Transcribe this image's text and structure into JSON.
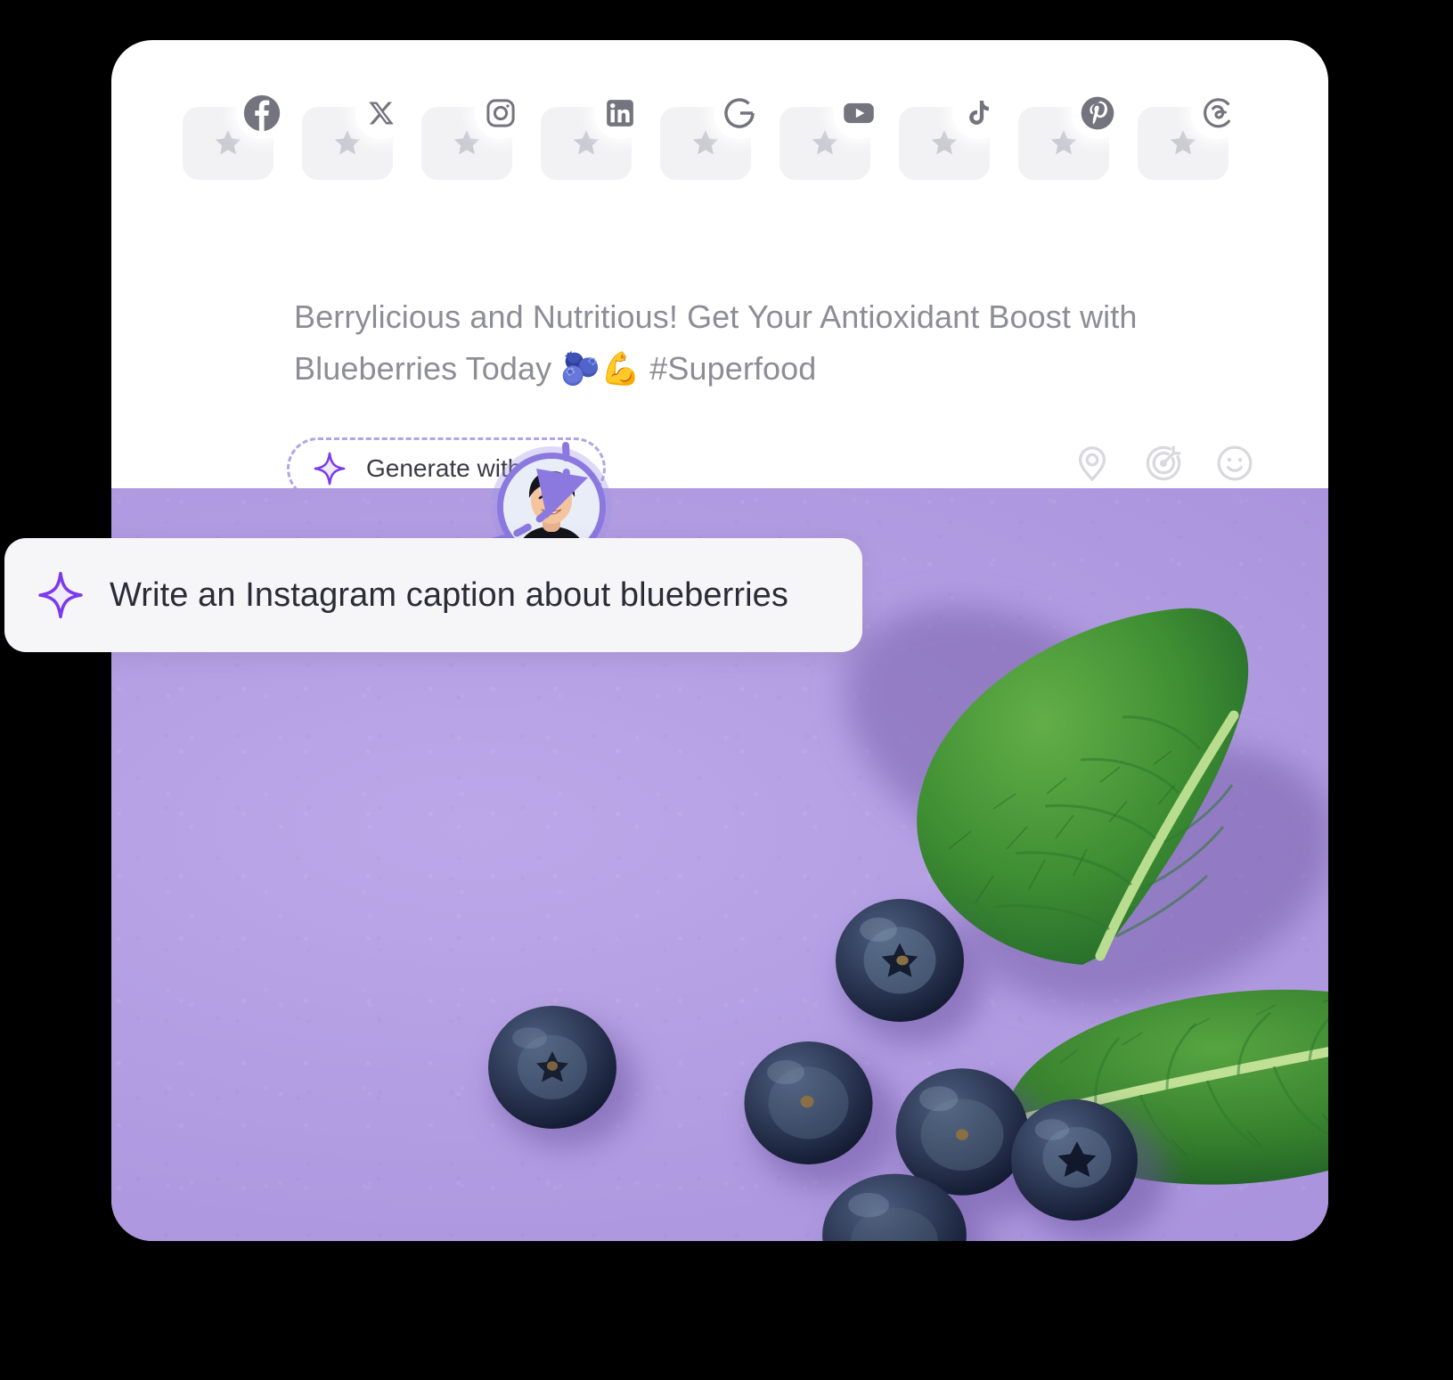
{
  "card": {
    "caption": "Berrylicious and Nutritious! Get Your Antioxidant Boost with Blueberries Today 🫐💪 #Superfood"
  },
  "social_strip": {
    "name": "social-network-selector",
    "items": [
      {
        "id": "facebook",
        "label": "Facebook",
        "icon": "facebook-icon",
        "star": "star-icon",
        "selected": false
      },
      {
        "id": "x",
        "label": "X",
        "icon": "x-icon",
        "star": "star-icon",
        "selected": false
      },
      {
        "id": "instagram",
        "label": "Instagram",
        "icon": "instagram-icon",
        "star": "star-icon",
        "selected": false
      },
      {
        "id": "linkedin",
        "label": "LinkedIn",
        "icon": "linkedin-icon",
        "star": "star-icon",
        "selected": false
      },
      {
        "id": "google",
        "label": "Google Business",
        "icon": "google-icon",
        "star": "star-icon",
        "selected": false
      },
      {
        "id": "youtube",
        "label": "YouTube",
        "icon": "youtube-icon",
        "star": "star-icon",
        "selected": false
      },
      {
        "id": "tiktok",
        "label": "TikTok",
        "icon": "tiktok-icon",
        "star": "star-icon",
        "selected": false
      },
      {
        "id": "pinterest",
        "label": "Pinterest",
        "icon": "pinterest-icon",
        "star": "star-icon",
        "selected": false
      },
      {
        "id": "threads",
        "label": "Threads",
        "icon": "threads-icon",
        "star": "star-icon",
        "selected": false
      }
    ]
  },
  "generate_button": {
    "label": "Generate with AI",
    "icon": "sparkle-icon",
    "border_style": "dashed",
    "accent_color": "#b3a4e8"
  },
  "toolbar": {
    "icons": [
      {
        "id": "location",
        "name": "location-pin-icon"
      },
      {
        "id": "target",
        "name": "target-icon"
      },
      {
        "id": "emoji",
        "name": "smiley-icon"
      }
    ],
    "color": "#d8d8de"
  },
  "prompt_bubble": {
    "text": "Write an Instagram caption about blueberries",
    "icon": "sparkle-icon"
  },
  "avatar": {
    "name": "user-avatar",
    "ring_color": "#8b79e0"
  },
  "cursor": {
    "name": "cursor-arrow",
    "color": "#7c6ae0"
  },
  "media": {
    "name": "post-image",
    "description": "Blueberries and mint leaves on a lavender background",
    "background_color": "#b49ee6"
  },
  "colors": {
    "accent_purple": "#7c3aed",
    "page_background": "#000000",
    "card_background": "#ffffff",
    "tile_background": "#f2f2f5",
    "caption_text": "#8d8d96"
  }
}
